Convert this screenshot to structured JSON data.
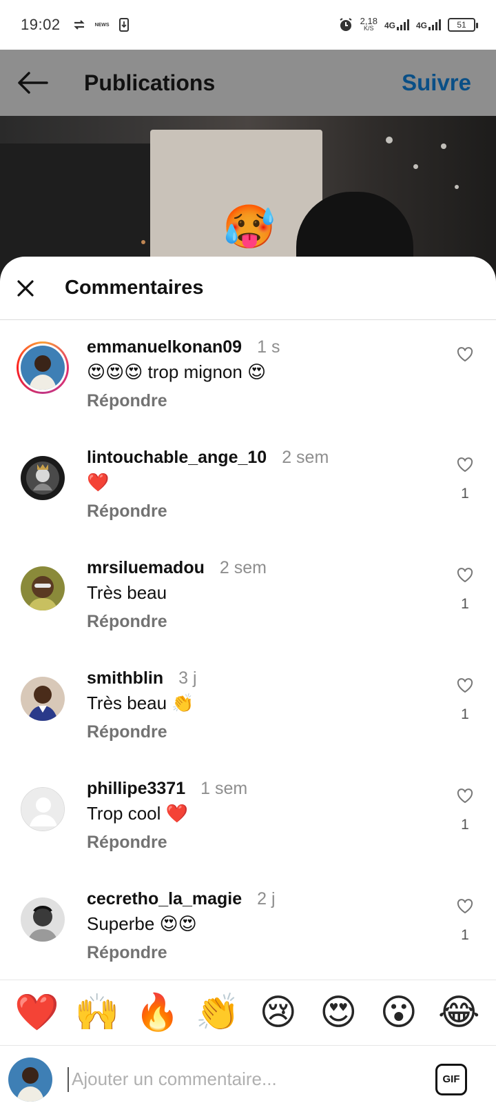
{
  "status_bar": {
    "time": "19:02",
    "net_speed_value": "2,18",
    "net_speed_unit": "K/S",
    "network_1": "4G",
    "network_2": "4G",
    "battery": "51",
    "small_icon_text": "NEWS"
  },
  "header": {
    "title": "Publications",
    "follow_label": "Suivre"
  },
  "sheet": {
    "title": "Commentaires"
  },
  "comments": [
    {
      "username": "emmanuelkonan09",
      "time": "1 s",
      "text": "😍😍😍 trop mignon 😍",
      "reply": "Répondre",
      "likes": ""
    },
    {
      "username": "lintouchable_ange_10",
      "time": "2 sem",
      "text": "❤️",
      "reply": "Répondre",
      "likes": "1"
    },
    {
      "username": "mrsiluemadou",
      "time": "2 sem",
      "text": "Très beau",
      "reply": "Répondre",
      "likes": "1"
    },
    {
      "username": "smithblin",
      "time": "3 j",
      "text": "Très beau 👏",
      "reply": "Répondre",
      "likes": "1"
    },
    {
      "username": "phillipe3371",
      "time": "1 sem",
      "text": "Trop cool ❤️",
      "reply": "Répondre",
      "likes": "1"
    },
    {
      "username": "cecretho_la_magie",
      "time": "2 j",
      "text": "Superbe 😍😍",
      "reply": "Répondre",
      "likes": "1"
    }
  ],
  "quick_reactions": [
    "❤️",
    "🙌",
    "🔥",
    "👏",
    "😢",
    "😍",
    "😮",
    "😂"
  ],
  "media": {
    "sticker": "🥵"
  },
  "composer": {
    "placeholder": "Ajouter un commentaire...",
    "gif_label": "GIF"
  },
  "colors": {
    "follow": "#0a4f86",
    "header_dim": "#8e8e8e"
  }
}
